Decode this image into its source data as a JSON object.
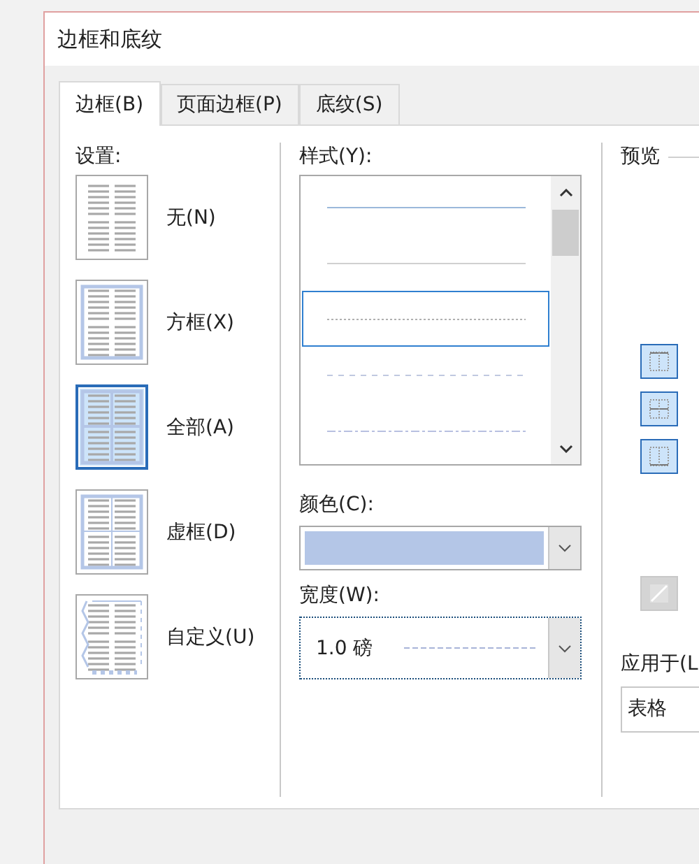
{
  "window": {
    "title": "边框和底纹"
  },
  "tabs": [
    {
      "label": "边框(B)",
      "selected": true
    },
    {
      "label": "页面边框(P)",
      "selected": false
    },
    {
      "label": "底纹(S)",
      "selected": false
    }
  ],
  "settings": {
    "label": "设置:",
    "items": [
      {
        "label": "无(N)",
        "kind": "none",
        "selected": false
      },
      {
        "label": "方框(X)",
        "kind": "box",
        "selected": false
      },
      {
        "label": "全部(A)",
        "kind": "all",
        "selected": true
      },
      {
        "label": "虚框(D)",
        "kind": "grid",
        "selected": false
      },
      {
        "label": "自定义(U)",
        "kind": "custom",
        "selected": false
      }
    ]
  },
  "style": {
    "label": "样式(Y):",
    "items": [
      {
        "kind": "solid",
        "selected": false
      },
      {
        "kind": "thin",
        "selected": false
      },
      {
        "kind": "dotted",
        "selected": true
      },
      {
        "kind": "dashed",
        "selected": false
      },
      {
        "kind": "dashdot",
        "selected": false
      }
    ]
  },
  "color": {
    "label": "颜色(C):",
    "color": "#b4c6e7"
  },
  "width": {
    "label": "宽度(W):",
    "value": "1.0 磅"
  },
  "preview": {
    "label": "预览",
    "buttons": [
      {
        "kind": "top",
        "disabled": false
      },
      {
        "kind": "middle",
        "disabled": false
      },
      {
        "kind": "bottom",
        "disabled": false
      },
      {
        "kind": "diagonal",
        "disabled": true
      }
    ]
  },
  "apply_to": {
    "label": "应用于(L",
    "value": "表格"
  }
}
